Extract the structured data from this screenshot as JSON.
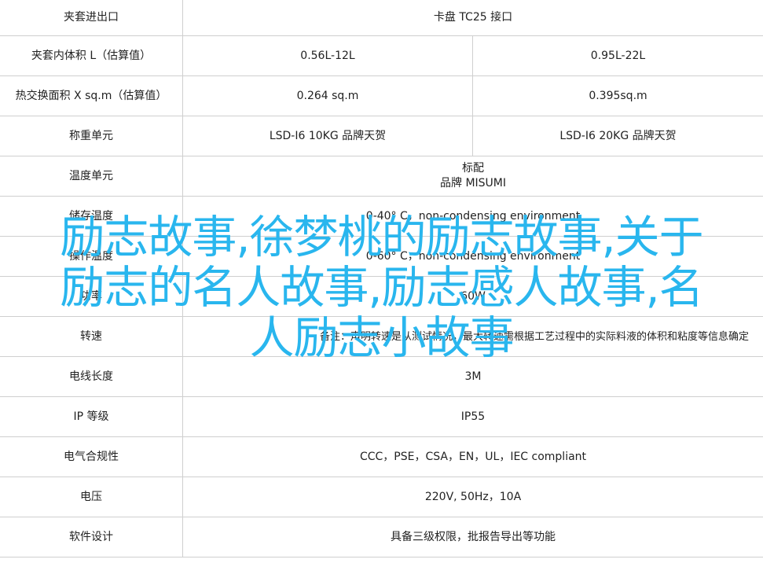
{
  "rows": [
    {
      "label": "夹套进出口",
      "span": "卡盘 TC25 接口"
    },
    {
      "label": "夹套内体积 L（估算值）",
      "v1": "0.56L-12L",
      "v2": "0.95L-22L"
    },
    {
      "label": "热交换面积 X sq.m（估算值）",
      "v1": "0.264 sq.m",
      "v2": "0.395sq.m"
    },
    {
      "label": "称重单元",
      "v1": "LSD-I6 10KG 品牌天贺",
      "v2": "LSD-I6 20KG 品牌天贺"
    },
    {
      "label": "温度单元",
      "span_l1": "标配",
      "span_l2": "品牌 MISUMI"
    },
    {
      "label": "储存温度",
      "span": "0-40° C，non-condensing environment"
    },
    {
      "label": "操作温度",
      "span": "0-60° C，non-condensing environment"
    },
    {
      "label": "功率",
      "span": "60W"
    },
    {
      "label": "转速",
      "span": "备注：声明转速是从测试情况，最大转速需根据工艺过程中的实际料液的体积和粘度等信息确定"
    },
    {
      "label": "电线长度",
      "span": "3M"
    },
    {
      "label": "IP 等级",
      "span": "IP55"
    },
    {
      "label": "电气合规性",
      "span": "CCC，PSE，CSA，EN，UL，IEC compliant"
    },
    {
      "label": "电压",
      "span": "220V, 50Hz，10A"
    },
    {
      "label": "软件设计",
      "span": "具备三级权限，批报告导出等功能"
    }
  ],
  "overlay": {
    "line1": "励志故事,徐梦桃的励志故事,关于",
    "line2": "励志的名人故事,励志感人故事,名",
    "line3": "人励志小故事"
  }
}
